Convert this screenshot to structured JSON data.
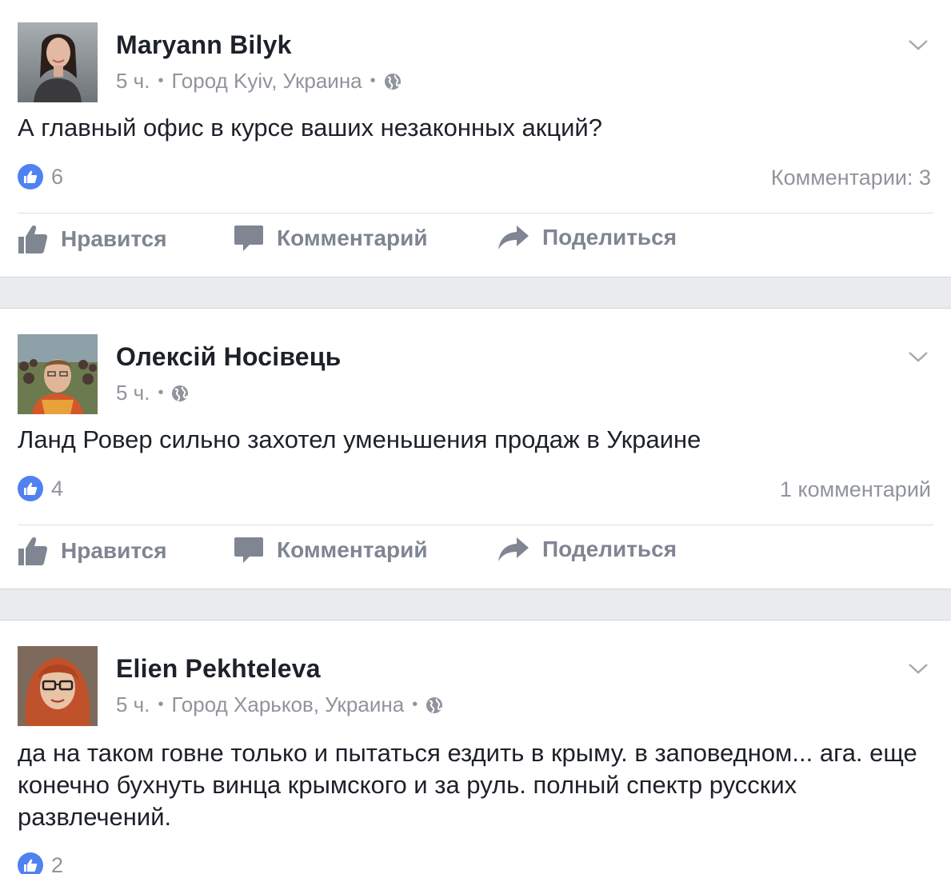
{
  "posts": [
    {
      "author": "Maryann Bilyk",
      "time": "5 ч.",
      "location": "Город Kyiv, Украина",
      "text": "А главный офис в курсе ваших незаконных акций?",
      "likes": "6",
      "comments": "Комментарии: 3"
    },
    {
      "author": "Олексій Носівець",
      "time": "5 ч.",
      "location": "",
      "text": "Ланд Ровер сильно захотел уменьшения продаж в Украине",
      "likes": "4",
      "comments": "1 комментарий"
    },
    {
      "author": "Elien Pekhteleva",
      "time": "5 ч.",
      "location": "Город Харьков, Украина",
      "text": "да на таком говне только и пытаться ездить в крыму. в заповедном... ага. еще конечно бухнуть винца крымского и за руль. полный спектр русских развлечений.",
      "likes": "2"
    }
  ],
  "actions": {
    "like": "Нравится",
    "comment": "Комментарий",
    "share": "Поделиться"
  },
  "icons": {
    "like": "thumbs-up-icon",
    "comment": "speech-bubble-icon",
    "share": "share-arrow-icon",
    "privacy": "globe-icon",
    "menu": "chevron-down-icon"
  },
  "colors": {
    "accent": "#4f82f0",
    "meta": "#90949c",
    "action": "#7f8591",
    "band": "#e9ebee"
  }
}
